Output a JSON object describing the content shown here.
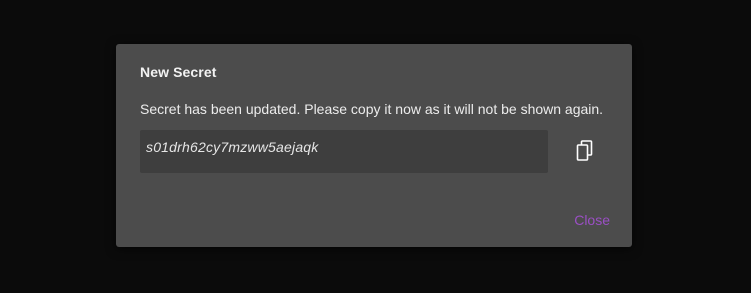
{
  "dialog": {
    "title": "New Secret",
    "message": "Secret has been updated. Please copy it now as it will not be shown again.",
    "secret_value": "s01drh62cy7mzww5aejaqk",
    "copy_icon": "copy-icon",
    "close_label": "Close"
  },
  "colors": {
    "backdrop": "#0b0b0b",
    "dialog_bg": "#4c4c4c",
    "secret_bg": "#3e3e3e",
    "accent": "#9a4fc4"
  }
}
